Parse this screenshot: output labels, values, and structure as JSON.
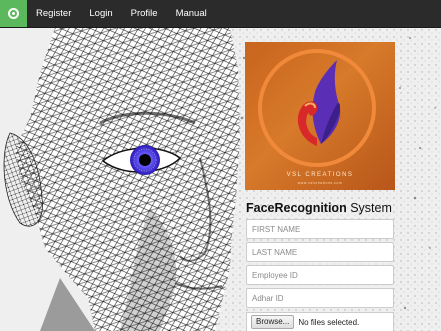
{
  "navbar": {
    "brand_icon": "app-logo-icon",
    "brand_color": "#5cb85c",
    "items": [
      {
        "label": "Register"
      },
      {
        "label": "Login"
      },
      {
        "label": "Profile"
      },
      {
        "label": "Manual"
      }
    ]
  },
  "hero": {
    "image": "wireframe-face-illustration",
    "eye_color": "#3b2bd6"
  },
  "logo": {
    "brand_text": "VSL CREATIONS",
    "brand_subtext": "www.vslcreations.com",
    "colors": {
      "background": "#c8641e",
      "ring": "#f08a3a",
      "mark_primary": "#5a2fb5",
      "mark_secondary": "#d8282a"
    }
  },
  "form": {
    "title_bold": "FaceRecognition",
    "title_rest": "System",
    "fields": [
      {
        "placeholder": "FIRST NAME",
        "value": ""
      },
      {
        "placeholder": "LAST NAME",
        "value": ""
      },
      {
        "placeholder": "Employee ID",
        "value": ""
      },
      {
        "placeholder": "Adhar ID",
        "value": ""
      }
    ],
    "file_input": {
      "button_label": "Browse...",
      "status": "No files selected."
    }
  }
}
